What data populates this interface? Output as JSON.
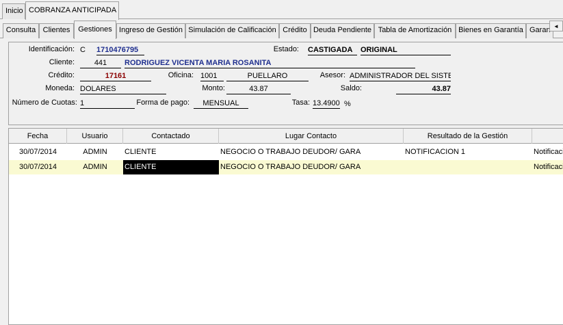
{
  "top_tabs": [
    {
      "label": "Inicio"
    },
    {
      "label": "COBRANZA ANTICIPADA"
    }
  ],
  "sub_tabs": [
    {
      "label": "Consulta"
    },
    {
      "label": "Clientes"
    },
    {
      "label": "Gestiones"
    },
    {
      "label": "Ingreso de Gestión"
    },
    {
      "label": "Simulación de Calificación"
    },
    {
      "label": "Crédito"
    },
    {
      "label": "Deuda Pendiente"
    },
    {
      "label": "Tabla de Amortización"
    },
    {
      "label": "Bienes en Garantía"
    },
    {
      "label": "Garan"
    }
  ],
  "tab_scroll_icon": "◄",
  "form": {
    "identificacion_label": "Identificación:",
    "identificacion_tipo": "C",
    "identificacion_valor": "1710476795",
    "estado_label": "Estado:",
    "estado_valor1": "CASTIGADA",
    "estado_valor2": "ORIGINAL",
    "cliente_label": "Cliente:",
    "cliente_codigo": "441",
    "cliente_nombre": "RODRIGUEZ VICENTA MARIA ROSANITA",
    "credito_label": "Crédito:",
    "credito_valor": "17161",
    "oficina_label": "Oficina:",
    "oficina_codigo": "1001",
    "oficina_nombre": "PUELLARO",
    "asesor_label": "Asesor:",
    "asesor_valor": "ADMINISTRADOR DEL SISTEMA",
    "moneda_label": "Moneda:",
    "moneda_valor": "DOLARES",
    "monto_label": "Monto:",
    "monto_valor": "43.87",
    "saldo_label": "Saldo:",
    "saldo_valor": "43.87",
    "cuotas_label": "Número de Cuotas:",
    "cuotas_valor": "1",
    "forma_pago_label": "Forma de pago:",
    "forma_pago_valor": "MENSUAL",
    "tasa_label": "Tasa:",
    "tasa_valor": "13.4900",
    "tasa_unit": "%"
  },
  "grid": {
    "headers": [
      "Fecha",
      "Usuario",
      "Contactado",
      "Lugar Contacto",
      "Resultado de la Gestión",
      ""
    ],
    "rows": [
      {
        "fecha": "30/07/2014",
        "usuario": "ADMIN",
        "contactado": "CLIENTE",
        "lugar": "NEGOCIO O TRABAJO DEUDOR/ GARA",
        "resultado": "NOTIFICACION 1",
        "extra": "Notificaci"
      },
      {
        "fecha": "30/07/2014",
        "usuario": "ADMIN",
        "contactado": "CLIENTE",
        "lugar": "NEGOCIO O TRABAJO DEUDOR/ GARA",
        "resultado": "",
        "extra": "Notificaci"
      }
    ]
  }
}
